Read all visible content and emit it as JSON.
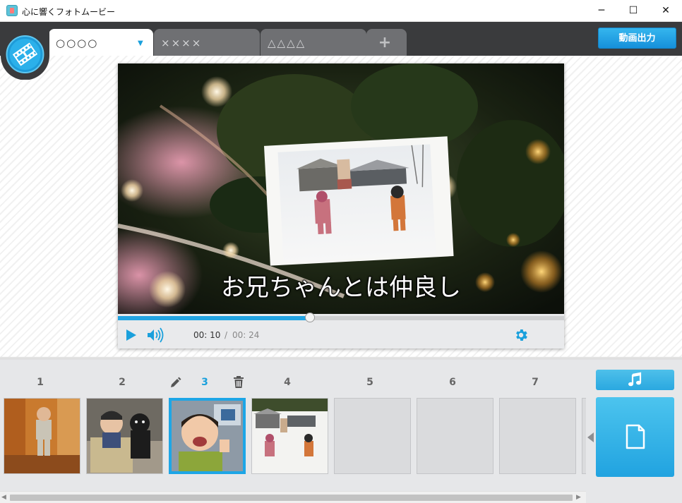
{
  "window": {
    "title": "心に響くフォトムービー",
    "minimize_glyph": "─",
    "maximize_glyph": "☐",
    "close_glyph": "✕"
  },
  "tabs": [
    {
      "label": "○○○○",
      "active": true
    },
    {
      "label": "××××",
      "active": false
    },
    {
      "label": "△△△△",
      "active": false
    }
  ],
  "tab_add_label": "+",
  "tab_dropdown_glyph": "▼",
  "export_button_label": "動画出力",
  "player": {
    "subtitle": "お兄ちゃんとは仲良し",
    "current_time": "00: 10",
    "separator": "/",
    "total_time": "00: 24",
    "progress_fraction": 0.43
  },
  "timeline": {
    "slots": [
      {
        "number": "1",
        "filled": true
      },
      {
        "number": "2",
        "filled": true
      },
      {
        "number": "3",
        "filled": true,
        "selected": true
      },
      {
        "number": "4",
        "filled": true
      },
      {
        "number": "5",
        "filled": false
      },
      {
        "number": "6",
        "filled": false
      },
      {
        "number": "7",
        "filled": false
      }
    ]
  },
  "colors": {
    "accent": "#1da6e6",
    "tabstrip": "#3a3b3d",
    "timeline_bg": "#e6e7e9"
  },
  "icons": [
    "app-icon",
    "film-logo-icon",
    "play-icon",
    "volume-icon",
    "gear-icon",
    "pencil-icon",
    "trash-icon",
    "music-note-icon",
    "document-icon"
  ]
}
